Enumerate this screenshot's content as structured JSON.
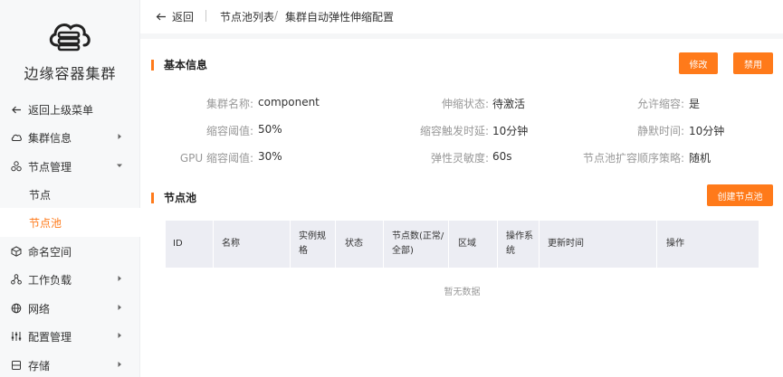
{
  "app": {
    "title": "边缘容器集群"
  },
  "sidebar": {
    "back_label": "返回上级菜单",
    "items": [
      {
        "label": "集群信息",
        "icon": "cloud-icon"
      },
      {
        "label": "节点管理",
        "icon": "nodes-icon"
      },
      {
        "label": "节点"
      },
      {
        "label": "节点池"
      },
      {
        "label": "命名空间",
        "icon": "cube-icon"
      },
      {
        "label": "工作负载",
        "icon": "workload-icon"
      },
      {
        "label": "网络",
        "icon": "globe-icon"
      },
      {
        "label": "配置管理",
        "icon": "sliders-icon"
      },
      {
        "label": "存储",
        "icon": "storage-icon"
      }
    ]
  },
  "breadcrumb": {
    "back": "返回",
    "items": [
      "节点池列表",
      "集群自动弹性伸缩配置"
    ],
    "separator": "/"
  },
  "basic_info": {
    "title": "基本信息",
    "edit_button": "修改",
    "disable_button": "禁用",
    "fields": [
      {
        "label": "集群名称:",
        "value": "component"
      },
      {
        "label": "伸缩状态:",
        "value": "待激活"
      },
      {
        "label": "允许缩容:",
        "value": "是"
      },
      {
        "label": "缩容阈值:",
        "value": "50%"
      },
      {
        "label": "缩容触发时延:",
        "value": "10分钟"
      },
      {
        "label": "静默时间:",
        "value": "10分钟"
      },
      {
        "label": "GPU 缩容阈值:",
        "value": "30%"
      },
      {
        "label": "弹性灵敏度:",
        "value": "60s"
      },
      {
        "label": "节点池扩容顺序策略:",
        "value": "随机"
      }
    ]
  },
  "node_pool": {
    "title": "节点池",
    "create_button": "创建节点池",
    "columns": [
      "ID",
      "名称",
      "实例规格",
      "状态",
      "节点数(正常/全部)",
      "区域",
      "操作系统",
      "更新时间",
      "操作"
    ],
    "empty_text": "暂无数据"
  },
  "colors": {
    "accent": "#ff7a1a"
  }
}
